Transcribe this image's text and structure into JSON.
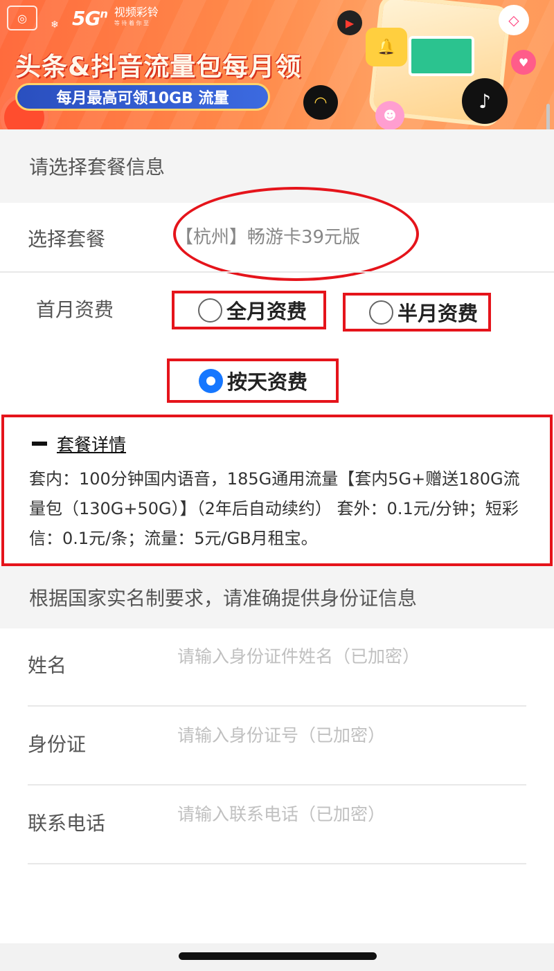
{
  "banner": {
    "title": "头条&抖音流量包每月领",
    "pill": "每月最高可领10GB 流量",
    "brand_5g": "5G",
    "brand_5g_sup": "n",
    "brand_name": "视频彩铃",
    "brand_sub": "等 待 着 你 至"
  },
  "plan_section": {
    "header": "请选择套餐信息",
    "plan_label": "选择套餐",
    "plan_value": "【杭州】畅游卡39元版",
    "first_month_label": "首月资费",
    "options": [
      {
        "label": "全月资费",
        "checked": false
      },
      {
        "label": "半月资费",
        "checked": false
      },
      {
        "label": "按天资费",
        "checked": true
      }
    ]
  },
  "details": {
    "title": "套餐详情",
    "text": "套内：100分钟国内语音，185G通用流量【套内5G+赠送180G流量包（130G+50G）】（2年后自动续约） 套外：0.1元/分钟；短彩信：0.1元/条；流量：5元/GB月租宝。"
  },
  "id_section": {
    "header": "根据国家实名制要求，请准确提供身份证信息",
    "fields": [
      {
        "label": "姓名",
        "placeholder": "请输入身份证件姓名（已加密）"
      },
      {
        "label": "身份证",
        "placeholder": "请输入身份证号（已加密）"
      },
      {
        "label": "联系电话",
        "placeholder": "请输入联系电话（已加密）"
      }
    ]
  },
  "colors": {
    "highlight_red": "#e5141b",
    "radio_blue": "#1677ff",
    "banner_orange": "#ff7a45"
  }
}
